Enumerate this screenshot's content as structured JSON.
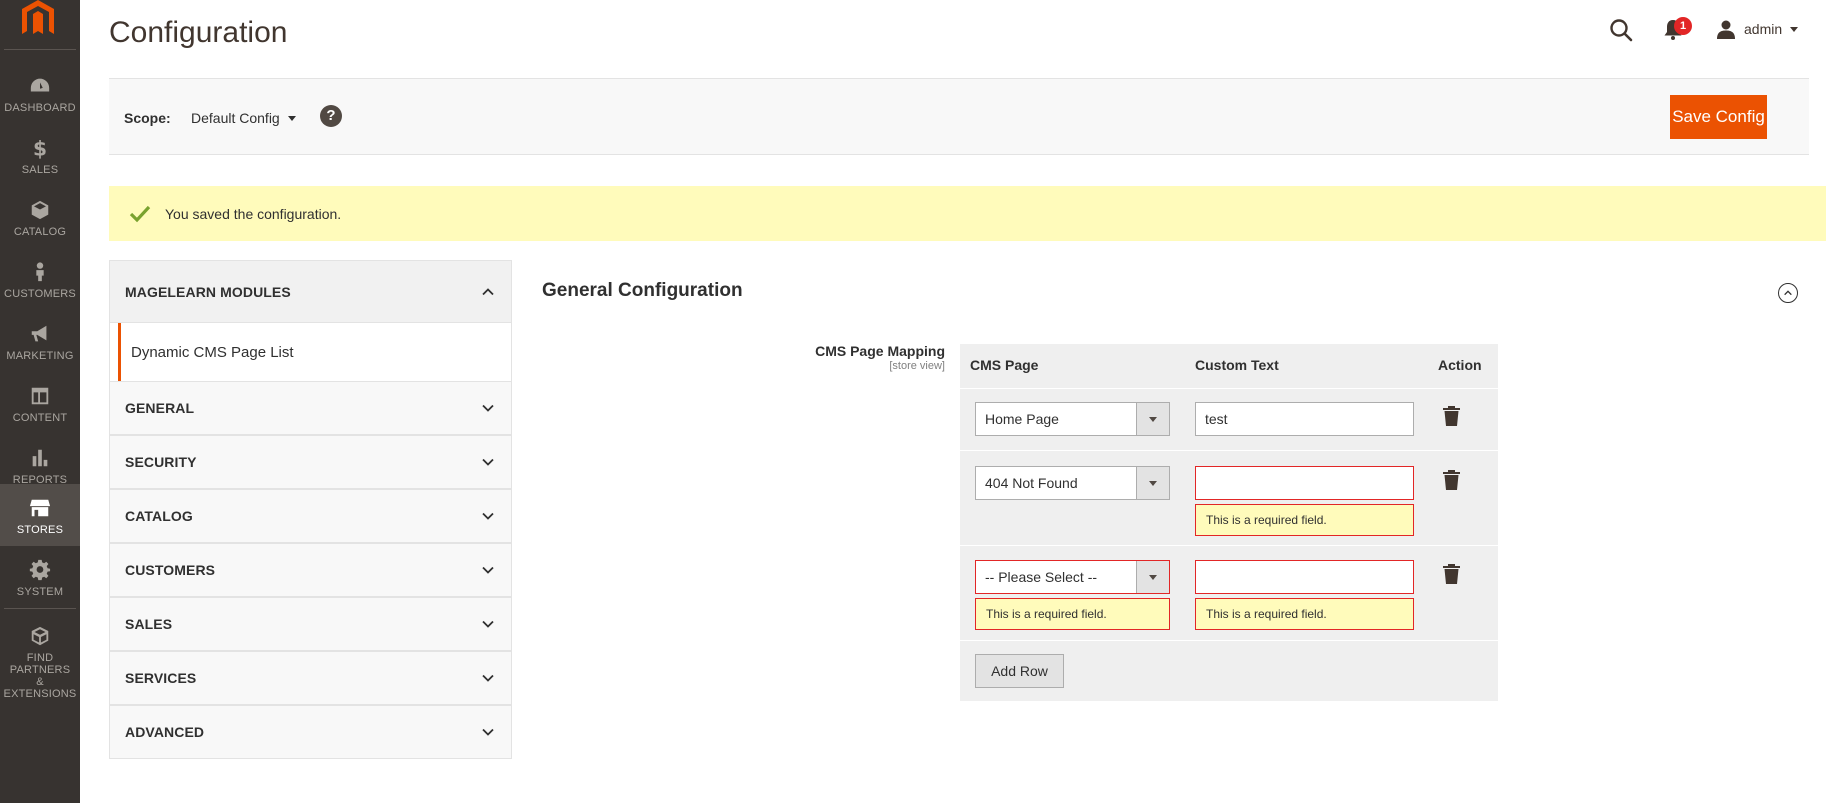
{
  "sidebar": {
    "logo_icon": "magento-logo-icon",
    "items": [
      {
        "label": "DASHBOARD",
        "icon": "dashboard-icon"
      },
      {
        "label": "SALES",
        "icon": "dollar-icon"
      },
      {
        "label": "CATALOG",
        "icon": "cube-icon"
      },
      {
        "label": "CUSTOMERS",
        "icon": "person-icon"
      },
      {
        "label": "MARKETING",
        "icon": "megaphone-icon"
      },
      {
        "label": "CONTENT",
        "icon": "layout-icon"
      },
      {
        "label": "REPORTS",
        "icon": "bar-chart-icon"
      },
      {
        "label": "STORES",
        "icon": "store-icon"
      },
      {
        "label": "SYSTEM",
        "icon": "gear-icon"
      },
      {
        "label_line1": "FIND PARTNERS",
        "label_line2": "& EXTENSIONS",
        "icon": "boxes-icon"
      }
    ],
    "active": "STORES"
  },
  "header": {
    "title": "Configuration",
    "notifications_count": "1",
    "user": "admin"
  },
  "scope": {
    "label": "Scope:",
    "value": "Default Config",
    "help": "?",
    "save_label": "Save Config"
  },
  "message": {
    "text": "You saved the configuration.",
    "color": "#79a22e"
  },
  "tabs": {
    "open_group": "MAGELEARN MODULES",
    "open_group_link": "Dynamic CMS Page List",
    "groups": [
      "GENERAL",
      "SECURITY",
      "CATALOG",
      "CUSTOMERS",
      "SALES",
      "SERVICES",
      "ADVANCED"
    ]
  },
  "section": {
    "title": "General Configuration",
    "field_label": "CMS Page Mapping",
    "field_scope": "[store view]",
    "columns": [
      "CMS Page",
      "Custom Text",
      "Action"
    ],
    "rows": [
      {
        "cms_page": "Home Page",
        "custom_text": "test",
        "page_error": "",
        "text_error": ""
      },
      {
        "cms_page": "404 Not Found",
        "custom_text": "",
        "page_error": "",
        "text_error": "This is a required field."
      },
      {
        "cms_page": "-- Please Select --",
        "custom_text": "",
        "page_error": "This is a required field.",
        "text_error": "This is a required field."
      }
    ],
    "add_row_label": "Add Row"
  },
  "colors": {
    "accent": "#eb5202",
    "error": "#e22626",
    "sidebar_bg": "#373330"
  }
}
